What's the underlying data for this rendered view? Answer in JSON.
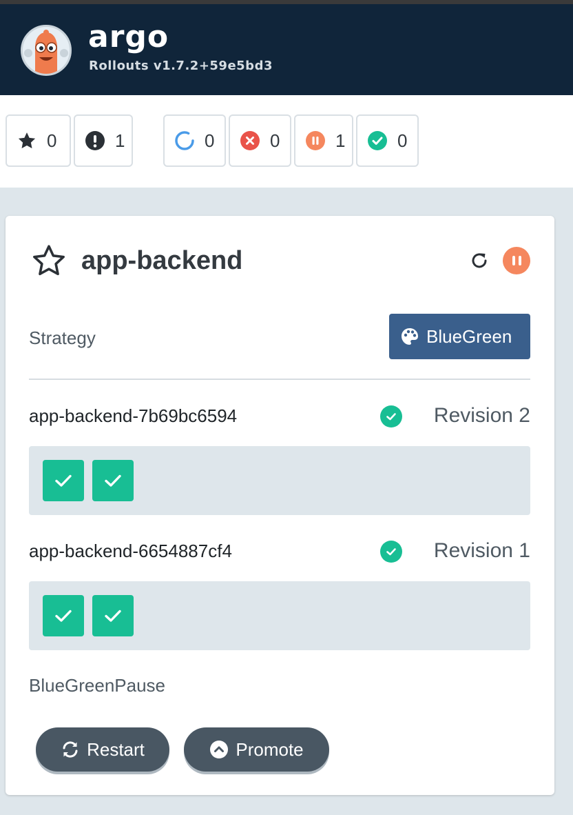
{
  "app": {
    "brand": "argo",
    "version": "Rollouts v1.7.2+59e5bd3"
  },
  "filters": [
    {
      "icon": "star-icon",
      "count": "0"
    },
    {
      "icon": "exclamation-icon",
      "count": "1"
    },
    {
      "icon": "progressing-icon",
      "count": "0"
    },
    {
      "icon": "degraded-icon",
      "count": "0"
    },
    {
      "icon": "paused-icon",
      "count": "1"
    },
    {
      "icon": "healthy-icon",
      "count": "0"
    }
  ],
  "rollout": {
    "name": "app-backend",
    "status": "paused",
    "strategy_label": "Strategy",
    "strategy": "BlueGreen",
    "replica_sets": [
      {
        "name": "app-backend-7b69bc6594",
        "revision": "Revision 2",
        "pods": 2
      },
      {
        "name": "app-backend-6654887cf4",
        "revision": "Revision 1",
        "pods": 2
      }
    ],
    "step": "BlueGreenPause",
    "actions": {
      "restart": "Restart",
      "promote": "Promote"
    }
  },
  "colors": {
    "header": "#10253a",
    "healthy": "#18be94",
    "paused": "#f5875e",
    "degraded": "#e9534a",
    "progressing": "#4a9be8",
    "strategy_button": "#3a5f8c",
    "action_button": "#495763"
  }
}
